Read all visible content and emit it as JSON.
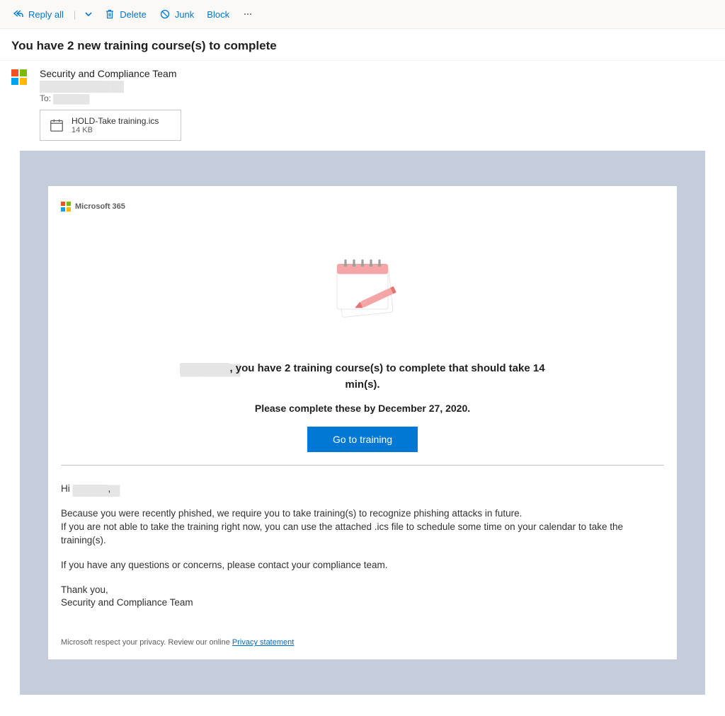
{
  "toolbar": {
    "reply_all": "Reply all",
    "delete": "Delete",
    "junk": "Junk",
    "block": "Block"
  },
  "email": {
    "subject": "You have 2 new training course(s) to complete",
    "from_name": "Security and Compliance Team",
    "from_address_redacted": "████████████",
    "to_label": "To:",
    "to_value_redacted": "██████"
  },
  "attachment": {
    "name": "HOLD-Take training.ics",
    "size": "14 KB"
  },
  "body": {
    "brand": "Microsoft 365",
    "headline_name_redacted": "████████",
    "headline_rest": ", you have 2 training course(s) to complete that should take 14 min(s).",
    "subline": "Please complete these by December 27, 2020.",
    "cta": "Go to training",
    "greeting_prefix": "Hi ",
    "greeting_name_redacted": "███████",
    "greeting_suffix": ",",
    "p1_line1": "Because you were recently phished, we require you to take training(s) to recognize phishing attacks in future.",
    "p1_line2": "If you are not able to take the training right now, you can use the attached .ics file to schedule some time on your calendar to take the training(s).",
    "p2": "If you have any questions or concerns, please contact your compliance team.",
    "thanks": "Thank you,",
    "signoff": "Security and Compliance Team",
    "footer_text": "Microsoft respect your privacy. Review our online ",
    "footer_link": "Privacy statement"
  }
}
